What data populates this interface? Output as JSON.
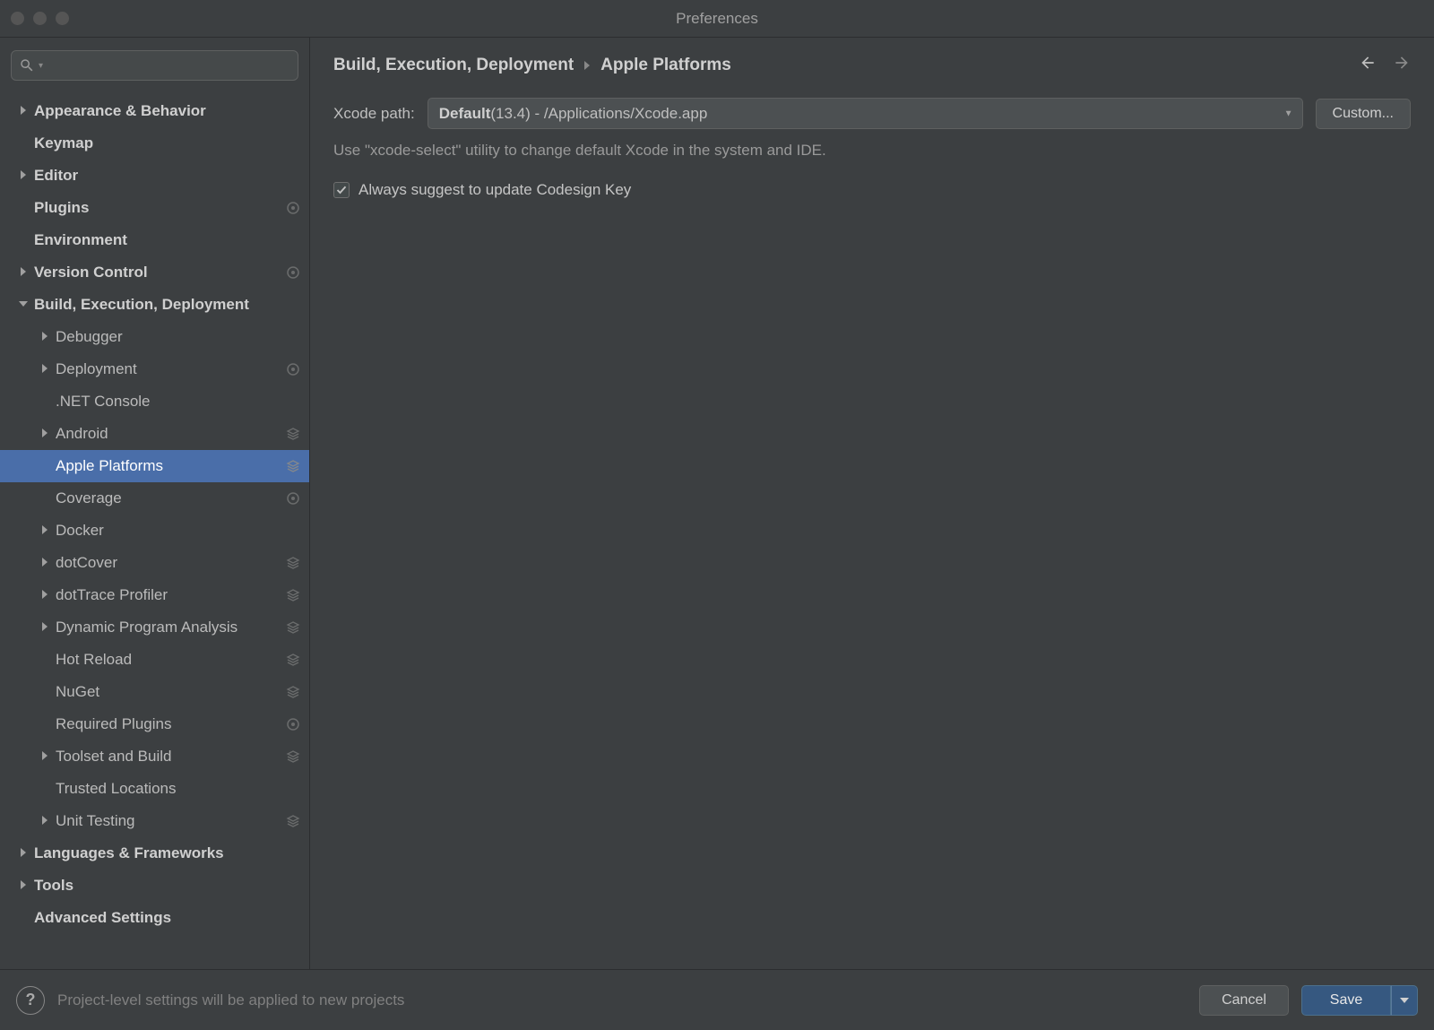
{
  "window": {
    "title": "Preferences"
  },
  "search": {
    "placeholder": ""
  },
  "tree": {
    "items": [
      {
        "label": "Appearance & Behavior",
        "level": 0,
        "chevron": "right",
        "badge": ""
      },
      {
        "label": "Keymap",
        "level": 0,
        "chevron": "",
        "badge": ""
      },
      {
        "label": "Editor",
        "level": 0,
        "chevron": "right",
        "badge": ""
      },
      {
        "label": "Plugins",
        "level": 0,
        "chevron": "",
        "badge": "project"
      },
      {
        "label": "Environment",
        "level": 0,
        "chevron": "",
        "badge": ""
      },
      {
        "label": "Version Control",
        "level": 0,
        "chevron": "right",
        "badge": "project"
      },
      {
        "label": "Build, Execution, Deployment",
        "level": 0,
        "chevron": "down",
        "badge": ""
      },
      {
        "label": "Debugger",
        "level": 1,
        "chevron": "right",
        "badge": ""
      },
      {
        "label": "Deployment",
        "level": 1,
        "chevron": "right",
        "badge": "project"
      },
      {
        "label": ".NET Console",
        "level": 1,
        "chevron": "",
        "badge": ""
      },
      {
        "label": "Android",
        "level": 1,
        "chevron": "right",
        "badge": "layers"
      },
      {
        "label": "Apple Platforms",
        "level": 1,
        "chevron": "",
        "badge": "layers",
        "selected": true
      },
      {
        "label": "Coverage",
        "level": 1,
        "chevron": "",
        "badge": "project"
      },
      {
        "label": "Docker",
        "level": 1,
        "chevron": "right",
        "badge": ""
      },
      {
        "label": "dotCover",
        "level": 1,
        "chevron": "right",
        "badge": "layers"
      },
      {
        "label": "dotTrace Profiler",
        "level": 1,
        "chevron": "right",
        "badge": "layers"
      },
      {
        "label": "Dynamic Program Analysis",
        "level": 1,
        "chevron": "right",
        "badge": "layers"
      },
      {
        "label": "Hot Reload",
        "level": 1,
        "chevron": "",
        "badge": "layers"
      },
      {
        "label": "NuGet",
        "level": 1,
        "chevron": "",
        "badge": "layers"
      },
      {
        "label": "Required Plugins",
        "level": 1,
        "chevron": "",
        "badge": "project"
      },
      {
        "label": "Toolset and Build",
        "level": 1,
        "chevron": "right",
        "badge": "layers"
      },
      {
        "label": "Trusted Locations",
        "level": 1,
        "chevron": "",
        "badge": ""
      },
      {
        "label": "Unit Testing",
        "level": 1,
        "chevron": "right",
        "badge": "layers"
      },
      {
        "label": "Languages & Frameworks",
        "level": 0,
        "chevron": "right",
        "badge": ""
      },
      {
        "label": "Tools",
        "level": 0,
        "chevron": "right",
        "badge": ""
      },
      {
        "label": "Advanced Settings",
        "level": 0,
        "chevron": "",
        "badge": ""
      }
    ]
  },
  "breadcrumb": {
    "parent": "Build, Execution, Deployment",
    "current": "Apple Platforms"
  },
  "main": {
    "xcode_label": "Xcode path:",
    "xcode_bold": "Default",
    "xcode_rest": " (13.4) - /Applications/Xcode.app",
    "custom_button": "Custom...",
    "hint": "Use \"xcode-select\" utility to change default Xcode in the system and IDE.",
    "codesign_label": "Always suggest to update Codesign Key",
    "codesign_checked": true
  },
  "footer": {
    "hint": "Project-level settings will be applied to new projects",
    "cancel": "Cancel",
    "save": "Save"
  }
}
